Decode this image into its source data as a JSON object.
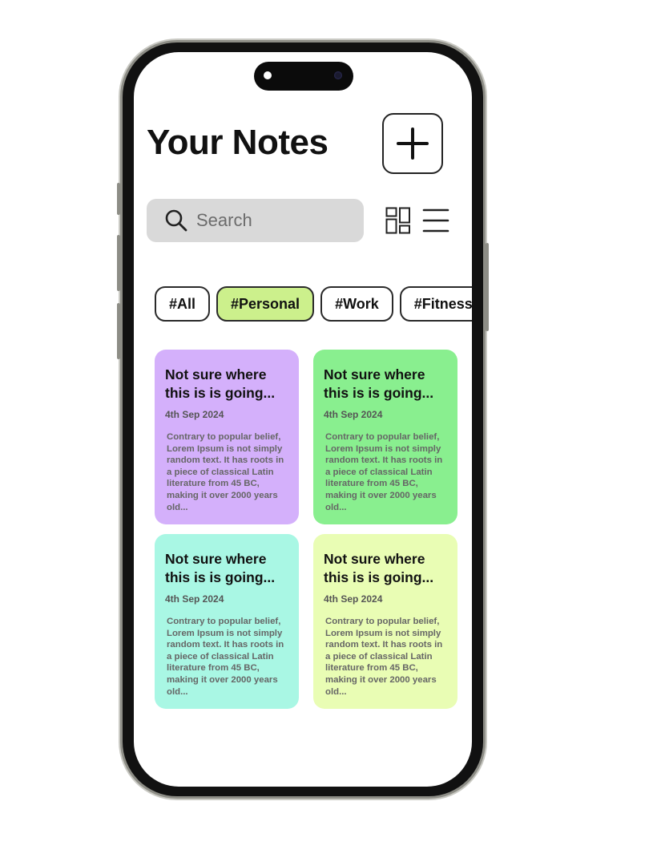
{
  "header": {
    "title": "Your Notes",
    "add_icon": "plus-icon"
  },
  "search": {
    "placeholder": "Search",
    "icon": "search-icon"
  },
  "view_toggles": {
    "grid_icon": "grid-view-icon",
    "list_icon": "list-view-icon"
  },
  "tags": [
    {
      "label": "#All",
      "active": false
    },
    {
      "label": "#Personal",
      "active": true
    },
    {
      "label": "#Work",
      "active": false
    },
    {
      "label": "#Fitness",
      "active": false
    }
  ],
  "notes": [
    {
      "title": "Not sure where this is is going...",
      "date": "4th Sep 2024",
      "body": "Contrary to popular belief, Lorem Ipsum is not simply random text. It has roots in a piece of classical Latin literature from 45 BC, making it over 2000 years old...",
      "color": "#d4b0fb"
    },
    {
      "title": "Not sure where this is is going...",
      "date": "4th Sep 2024",
      "body": "Contrary to popular belief, Lorem Ipsum is not simply random text. It has roots in a piece of classical Latin literature from 45 BC, making it over 2000 years old...",
      "color": "#89ef8f"
    },
    {
      "title": "Not sure where this is is going...",
      "date": "4th Sep 2024",
      "body": "Contrary to popular belief, Lorem Ipsum is not simply random text. It has roots in a piece of classical Latin literature from 45 BC, making it over 2000 years old...",
      "color": "#a9f7e4"
    },
    {
      "title": "Not sure where this is is going...",
      "date": "4th Sep 2024",
      "body": "Contrary to popular belief, Lorem Ipsum is not simply random text. It has roots in a piece of classical Latin literature from 45 BC, making it over 2000 years old...",
      "color": "#e9fdb4"
    }
  ],
  "colors": {
    "active_tag": "#ccf08c",
    "search_bg": "#d9d9d9"
  }
}
